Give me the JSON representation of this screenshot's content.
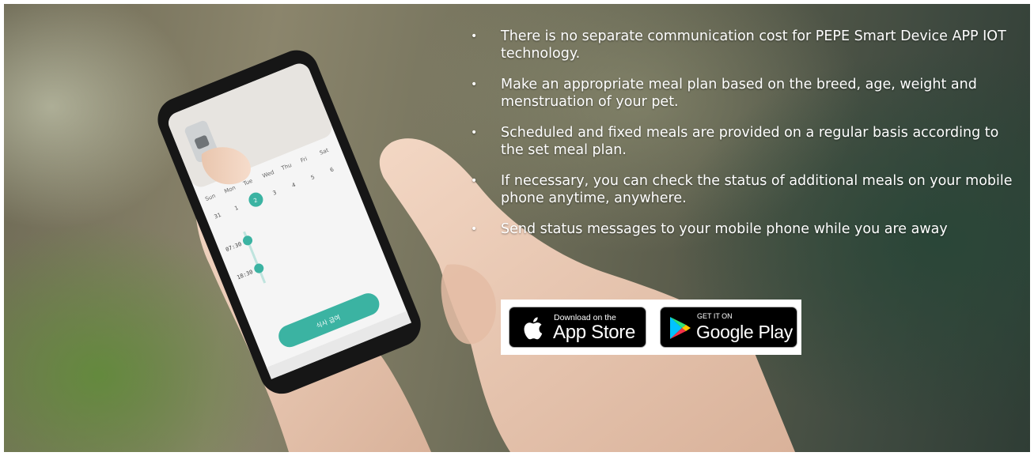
{
  "features": [
    "There is no separate communication cost for PEPE Smart Device APP IOT technology.",
    "Make an appropriate meal plan based on the breed, age, weight and menstruation of your pet.",
    "Scheduled and fixed meals are provided on a regular basis according to the set meal plan.",
    "If necessary, you can check the status of additional meals on your mobile phone anytime, anywhere.",
    "Send status messages to your mobile phone while you are away"
  ],
  "bullet_glyph": "•",
  "badges": {
    "app_store": {
      "small": "Download on the",
      "big": "App Store"
    },
    "google_play": {
      "small": "GET IT ON",
      "big": "Google Play"
    }
  },
  "phone": {
    "days": [
      "Sun",
      "Mon",
      "Tue",
      "Wed",
      "Thu",
      "Fri",
      "Sat"
    ],
    "dates": [
      "31",
      "1",
      "2",
      "3",
      "4",
      "5",
      "6"
    ],
    "meals": [
      "07:30",
      "18:30"
    ],
    "action_button": "식사 급여"
  }
}
